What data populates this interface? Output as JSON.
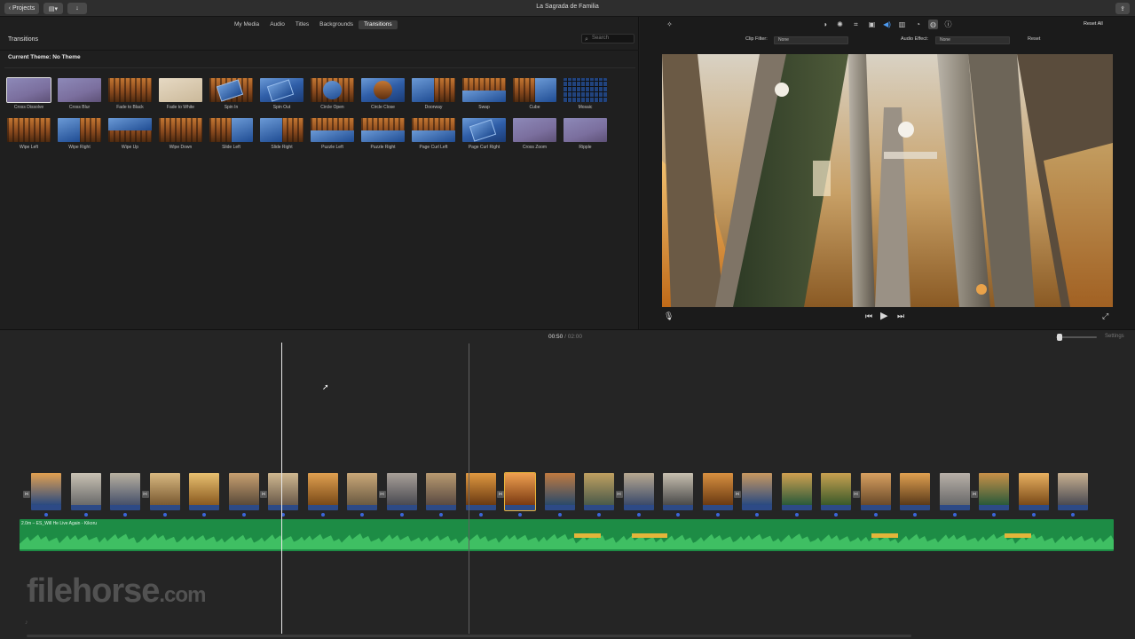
{
  "window": {
    "title": "La Sagrada de Familia",
    "projects_label": "Projects"
  },
  "library": {
    "tabs": [
      "My Media",
      "Audio",
      "Titles",
      "Backgrounds",
      "Transitions"
    ],
    "active_tab": "Transitions",
    "section_title": "Transitions",
    "search_placeholder": "Search",
    "current_theme": "Current Theme: No Theme",
    "transitions": [
      {
        "label": "Cross Dissolve",
        "style": "lav",
        "selected": true
      },
      {
        "label": "Cross Blur",
        "style": "lav"
      },
      {
        "label": "Fade to Black",
        "style": "forest"
      },
      {
        "label": "Fade to White",
        "style": "pale"
      },
      {
        "label": "Spin In",
        "style": "forest card"
      },
      {
        "label": "Spin Out",
        "style": "blue card"
      },
      {
        "label": "Circle Open",
        "style": "forest circle"
      },
      {
        "label": "Circle Close",
        "style": "blue circle-f"
      },
      {
        "label": "Doorway",
        "style": "forest half-l"
      },
      {
        "label": "Swap",
        "style": "forest half-b"
      },
      {
        "label": "Cube",
        "style": "forest half-r"
      },
      {
        "label": "Mosaic",
        "style": "mosaic"
      },
      {
        "label": "Wipe Left",
        "style": "forest"
      },
      {
        "label": "Wipe Right",
        "style": "forest half-l"
      },
      {
        "label": "Wipe Up",
        "style": "forest half-t"
      },
      {
        "label": "Wipe Down",
        "style": "forest"
      },
      {
        "label": "Slide Left",
        "style": "forest half-r"
      },
      {
        "label": "Slide Right",
        "style": "forest half-l"
      },
      {
        "label": "Puzzle Left",
        "style": "forest half-b"
      },
      {
        "label": "Puzzle Right",
        "style": "forest half-b"
      },
      {
        "label": "Page Curl Left",
        "style": "forest half-b"
      },
      {
        "label": "Page Curl Right",
        "style": "blue card"
      },
      {
        "label": "Cross Zoom",
        "style": "lav"
      },
      {
        "label": "Ripple",
        "style": "lav"
      }
    ]
  },
  "viewer": {
    "reset_all": "Reset All",
    "clip_filter_label": "Clip Filter:",
    "clip_filter_value": "None",
    "audio_effect_label": "Audio Effect:",
    "audio_effect_value": "None",
    "reset_label": "Reset"
  },
  "timeline": {
    "current_time": "00:50",
    "separator": "/",
    "total_time": "02:00",
    "settings_label": "Settings",
    "audio_track_label": "2.0m – ES_Will He Live Again - Kikoru",
    "clip_count": 27,
    "selected_clip_index": 12
  },
  "watermark": {
    "brand": "filehorse",
    "suffix": ".com"
  },
  "colors": {
    "audio_track": "#1d8c45",
    "selection": "#e8b43b",
    "accent_blue": "#4d9bf2"
  }
}
